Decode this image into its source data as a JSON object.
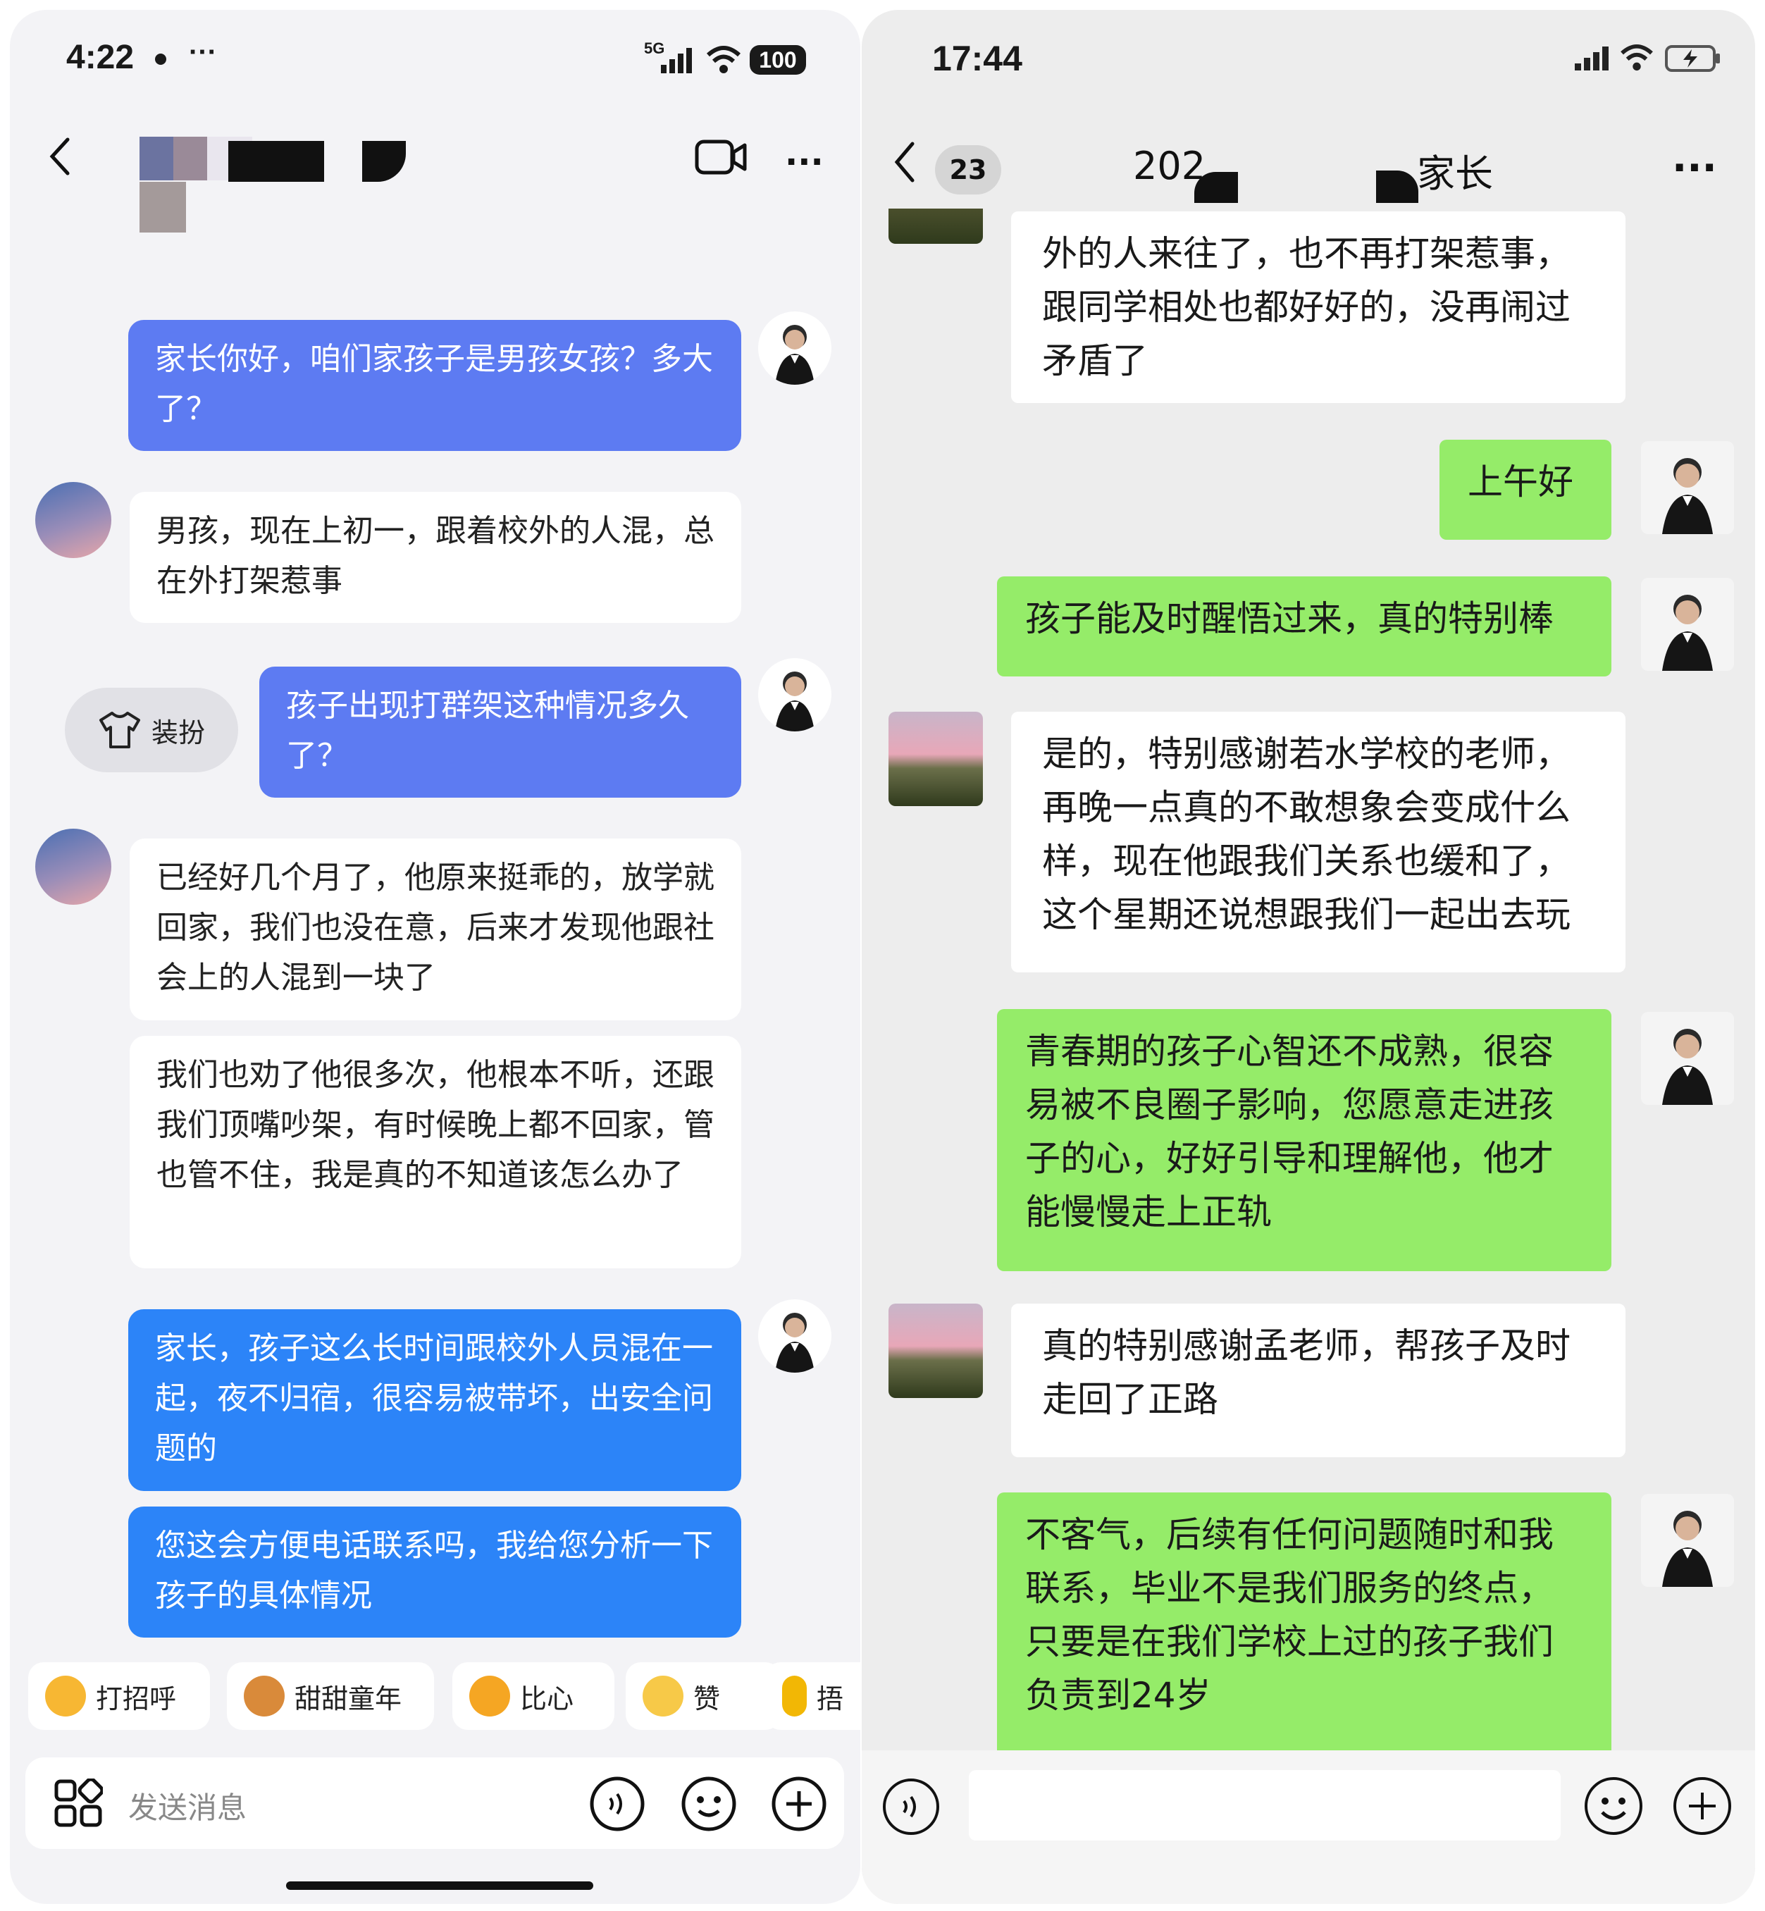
{
  "left": {
    "status": {
      "time": "4:22",
      "network": "5G",
      "battery": "100"
    },
    "header": {
      "redacted_name": ""
    },
    "messages": [
      {
        "side": "agent",
        "text": "家长你好，咱们家孩子是男孩女孩？多大了？"
      },
      {
        "side": "parent",
        "text": "男孩，现在上初一，跟着校外的人混，总在外打架惹事"
      },
      {
        "side": "agent",
        "text": "孩子出现打群架这种情况多久了？"
      },
      {
        "side": "parent",
        "text": "已经好几个月了，他原来挺乖的，放学就回家，我们也没在意，后来才发现他跟社会上的人混到一块了"
      },
      {
        "side": "parent",
        "text": "我们也劝了他很多次，他根本不听，还跟我们顶嘴吵架，有时候晚上都不回家，管也管不住，我是真的不知道该怎么办了"
      },
      {
        "side": "agent",
        "text": "家长，孩子这么长时间跟校外人员混在一起，夜不归宿，很容易被带坏，出安全问题的"
      },
      {
        "side": "agent",
        "text": "您这会方便电话联系吗，我给您分析一下孩子的具体情况"
      }
    ],
    "dress_button": "装扮",
    "quick_replies": [
      "打招呼",
      "甜甜童年",
      "比心",
      "赞",
      "捂"
    ],
    "input": {
      "placeholder": "发送消息"
    }
  },
  "right": {
    "status": {
      "time": "17:44"
    },
    "header": {
      "back_count": "23",
      "title_left": "202",
      "title_right": "家长"
    },
    "messages": [
      {
        "side": "parent",
        "text": "外的人来往了，也不再打架惹事，跟同学相处也都好好的，没再闹过矛盾了"
      },
      {
        "side": "agent",
        "text": "上午好"
      },
      {
        "side": "agent",
        "text": "孩子能及时醒悟过来，真的特别棒"
      },
      {
        "side": "parent",
        "text": "是的，特别感谢若水学校的老师，再晚一点真的不敢想象会变成什么样，现在他跟我们关系也缓和了，这个星期还说想跟我们一起出去玩"
      },
      {
        "side": "agent",
        "text": "青春期的孩子心智还不成熟，很容易被不良圈子影响，您愿意走进孩子的心，好好引导和理解他，他才能慢慢走上正轨"
      },
      {
        "side": "parent",
        "text": "真的特别感谢孟老师，帮孩子及时走回了正路"
      },
      {
        "side": "agent",
        "text": "不客气，后续有任何问题随时和我联系，毕业不是我们服务的终点，只要是在我们学校上过的孩子我们负责到24岁"
      }
    ]
  },
  "colors": {
    "left_bubble_agent": "#5d7bf2",
    "left_bubble_agent2": "#2c84f8",
    "right_bubble_agent": "#95ec69",
    "bubble_parent": "#ffffff"
  }
}
